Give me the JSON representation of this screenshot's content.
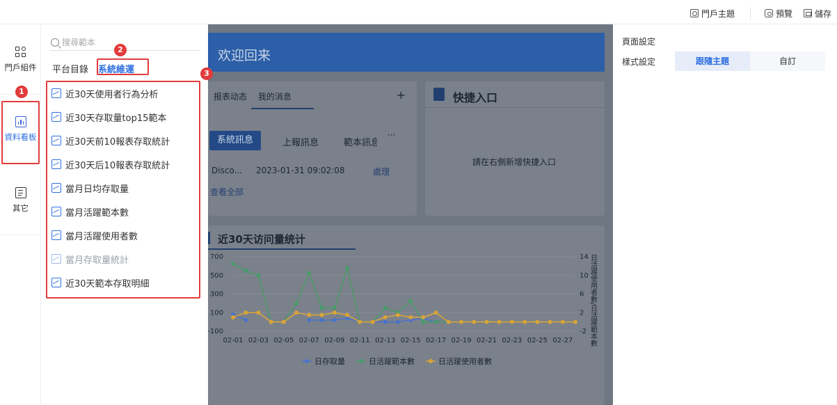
{
  "toolbar": {
    "portal_theme": "門戶主題",
    "preview": "預覽",
    "save": "儲存"
  },
  "rail": {
    "items": [
      {
        "label": "門戶組件",
        "icon": "components-grid-icon"
      },
      {
        "label": "資料看板",
        "icon": "chart-board-icon",
        "active": true
      },
      {
        "label": "其它",
        "icon": "document-icon"
      }
    ]
  },
  "annotations": {
    "badge1": "1",
    "badge2": "2",
    "badge3": "3"
  },
  "panel": {
    "search_placeholder": "搜尋範本",
    "tabs": [
      {
        "label": "平台目錄",
        "active": false
      },
      {
        "label": "系統維運",
        "active": true
      }
    ],
    "templates": [
      {
        "label": "近30天使用者行為分析",
        "muted": false
      },
      {
        "label": "近30天存取量top15範本",
        "muted": false
      },
      {
        "label": "近30天前10報表存取統計",
        "muted": false
      },
      {
        "label": "近30天后10報表存取統計",
        "muted": false
      },
      {
        "label": "當月日均存取量",
        "muted": false
      },
      {
        "label": "當月活躍範本數",
        "muted": false
      },
      {
        "label": "當月活躍使用者數",
        "muted": false
      },
      {
        "label": "當月存取量統計",
        "muted": true
      },
      {
        "label": "近30天範本存取明細",
        "muted": false
      }
    ]
  },
  "canvas": {
    "banner": "欢迎回来",
    "messages": {
      "tabs": [
        "报表动态",
        "我的消息"
      ],
      "plus": "+",
      "subtabs": [
        "系統訊息",
        "上報訊息",
        "範本訊息"
      ],
      "more": "···",
      "row": {
        "name": "Disco...",
        "time": "2023-01-31 09:02:08",
        "action": "處理"
      },
      "view_all": "查看全部"
    },
    "quick": {
      "title": "快捷入口",
      "empty": "請在右側新增快捷入口"
    },
    "chart_title": "近30天访问量统计"
  },
  "chart_data": {
    "type": "line",
    "title": "近30天访问量统计",
    "x": [
      "02-01",
      "02-02",
      "02-03",
      "02-04",
      "02-05",
      "02-06",
      "02-07",
      "02-08",
      "02-09",
      "02-10",
      "02-11",
      "02-12",
      "02-13",
      "02-14",
      "02-15",
      "02-16",
      "02-17",
      "02-18",
      "02-19",
      "02-20",
      "02-21",
      "02-22",
      "02-23",
      "02-24",
      "02-25",
      "02-26",
      "02-27",
      "02-28"
    ],
    "x_tick_labels": [
      "02-01",
      "02-03",
      "02-05",
      "02-07",
      "02-09",
      "02-11",
      "02-13",
      "02-15",
      "02-17",
      "02-19",
      "02-21",
      "02-23",
      "02-25",
      "02-27"
    ],
    "y_left_ticks": [
      "700",
      "500",
      "300",
      "100",
      "-100"
    ],
    "y_right_ticks": [
      "14",
      "10",
      "6",
      "2",
      "-2"
    ],
    "y_right_label": "日活躍使用者數/日活躍範本數",
    "ylim_left": [
      -100,
      700
    ],
    "ylim_right": [
      -2,
      14
    ],
    "series": [
      {
        "name": "日存取量",
        "axis": "left",
        "color": "#4a73c9",
        "values": [
          80,
          20,
          null,
          null,
          null,
          null,
          20,
          20,
          20,
          40,
          0,
          0,
          0,
          0,
          20,
          40,
          0,
          0,
          0,
          0,
          0,
          0,
          0,
          0,
          0,
          0,
          0,
          0
        ]
      },
      {
        "name": "日活躍範本數",
        "axis": "right",
        "color": "#4a9a6a",
        "values": [
          12.5,
          11,
          10,
          0,
          0,
          4,
          10.5,
          3,
          3,
          11.5,
          0,
          0,
          3,
          2,
          4.5,
          0,
          0,
          0,
          0,
          0,
          0,
          0,
          0,
          0,
          0,
          0,
          0,
          0
        ]
      },
      {
        "name": "日活躍使用者數",
        "axis": "right",
        "color": "#d9a43a",
        "values": [
          1,
          2,
          2,
          0,
          0,
          2,
          1.5,
          1.5,
          2,
          1.5,
          0,
          0,
          1,
          1.5,
          1,
          1,
          2,
          0,
          0,
          0,
          0,
          0,
          0,
          0,
          0,
          0,
          0,
          0
        ]
      }
    ]
  },
  "settings": {
    "page_settings": "頁面設定",
    "style_settings": "樣式設定",
    "style_options": [
      {
        "label": "跟隨主題",
        "active": true
      },
      {
        "label": "自訂",
        "active": false
      }
    ]
  },
  "colors": {
    "accent": "#2f6fe0",
    "annotation": "#e23b3b",
    "overlay": "#6f7782"
  }
}
